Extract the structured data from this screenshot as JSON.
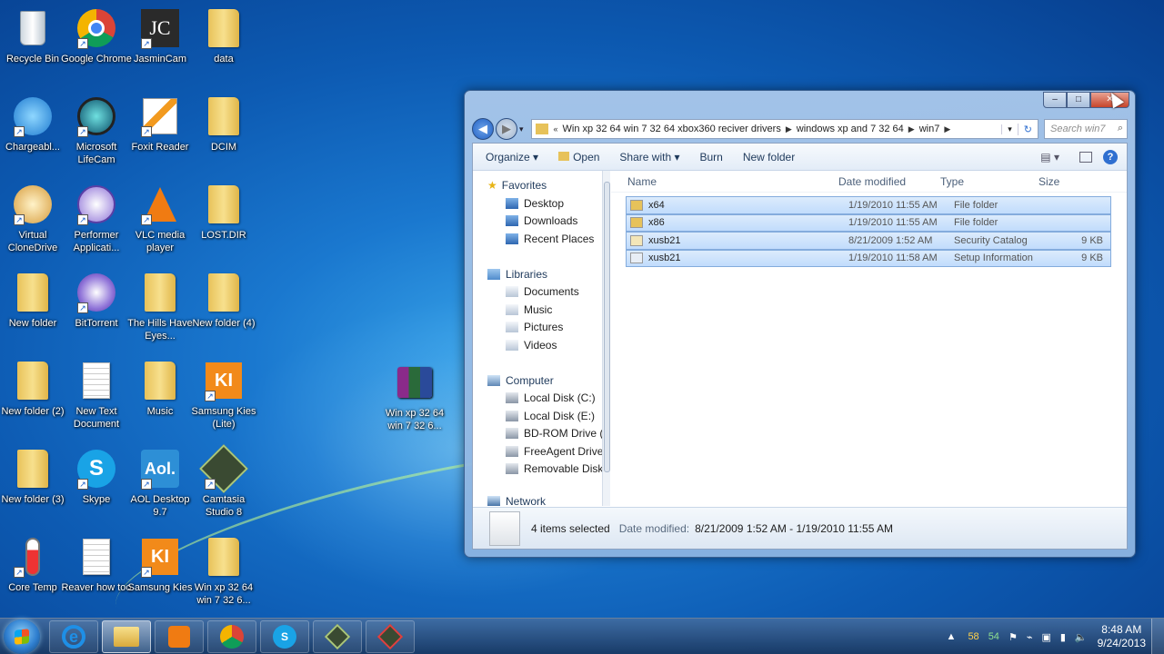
{
  "desktop": {
    "icons": [
      {
        "label": "Recycle Bin",
        "icon": "recycle-bin-icon"
      },
      {
        "label": "Google Chrome",
        "icon": "chrome-icon"
      },
      {
        "label": "JasminCam",
        "icon": "jasmincam-icon"
      },
      {
        "label": "data",
        "icon": "folder-icon"
      },
      {
        "label": "Chargeabl...",
        "icon": "charge-icon"
      },
      {
        "label": "Microsoft LifeCam",
        "icon": "lifecam-icon"
      },
      {
        "label": "Foxit Reader",
        "icon": "foxit-icon"
      },
      {
        "label": "DCIM",
        "icon": "folder-icon"
      },
      {
        "label": "Virtual CloneDrive",
        "icon": "clonedrive-icon"
      },
      {
        "label": "Performer Applicati...",
        "icon": "performer-icon"
      },
      {
        "label": "VLC media player",
        "icon": "vlc-icon"
      },
      {
        "label": "LOST.DIR",
        "icon": "folder-icon"
      },
      {
        "label": "New folder",
        "icon": "folder-icon"
      },
      {
        "label": "BitTorrent",
        "icon": "bittorrent-icon"
      },
      {
        "label": "The Hills Have Eyes...",
        "icon": "folder-icon"
      },
      {
        "label": "New folder (4)",
        "icon": "folder-icon"
      },
      {
        "label": "New folder (2)",
        "icon": "folder-icon"
      },
      {
        "label": "New Text Document",
        "icon": "text-document-icon"
      },
      {
        "label": "Music",
        "icon": "folder-icon"
      },
      {
        "label": "Samsung Kies (Lite)",
        "icon": "kies-lite-icon"
      },
      {
        "label": "New folder (3)",
        "icon": "folder-icon"
      },
      {
        "label": "Skype",
        "icon": "skype-icon"
      },
      {
        "label": "AOL Desktop 9.7",
        "icon": "aol-icon"
      },
      {
        "label": "Camtasia Studio 8",
        "icon": "camtasia-icon"
      },
      {
        "label": "Core Temp",
        "icon": "coretemp-icon"
      },
      {
        "label": "Reaver how too",
        "icon": "text-document-icon"
      },
      {
        "label": "Samsung Kies",
        "icon": "kies-icon"
      },
      {
        "label": "Win xp 32 64 win 7 32 6...",
        "icon": "folder-icon"
      }
    ],
    "archive_icon": {
      "label": "Win xp 32 64 win 7 32 6...",
      "icon": "winrar-archive-icon"
    }
  },
  "explorer": {
    "caption": {
      "minimize": "–",
      "maximize": "□",
      "close": "✕"
    },
    "nav": {
      "back": "◀",
      "forward": "▶",
      "recent": "▾"
    },
    "breadcrumb": {
      "overflow": "«",
      "items": [
        "Win xp 32 64 win 7 32 64 xbox360 reciver drivers",
        "windows xp and 7 32 64",
        "win7"
      ],
      "separator": "▶",
      "dropdown": "▾",
      "refresh": "↻"
    },
    "search_placeholder": "Search win7",
    "toolbar": {
      "organize": "Organize ▾",
      "open": "Open",
      "share_with": "Share with ▾",
      "burn": "Burn",
      "new_folder": "New folder",
      "view": "▤ ▾",
      "help": "?"
    },
    "nav_pane": {
      "favorites": "Favorites",
      "favorites_items": [
        "Desktop",
        "Downloads",
        "Recent Places"
      ],
      "libraries": "Libraries",
      "libraries_items": [
        "Documents",
        "Music",
        "Pictures",
        "Videos"
      ],
      "computer": "Computer",
      "computer_items": [
        "Local Disk (C:)",
        "Local Disk (E:)",
        "BD-ROM Drive (F",
        "FreeAgent Drive (",
        "Removable Disk ("
      ],
      "network": "Network"
    },
    "columns": {
      "name": "Name",
      "date": "Date modified",
      "type": "Type",
      "size": "Size"
    },
    "files": [
      {
        "name": "x64",
        "date": "1/19/2010 11:55 AM",
        "type": "File folder",
        "size": "",
        "icon": "folder-icon"
      },
      {
        "name": "x86",
        "date": "1/19/2010 11:55 AM",
        "type": "File folder",
        "size": "",
        "icon": "folder-icon"
      },
      {
        "name": "xusb21",
        "date": "8/21/2009 1:52 AM",
        "type": "Security Catalog",
        "size": "9 KB",
        "icon": "security-catalog-icon"
      },
      {
        "name": "xusb21",
        "date": "1/19/2010 11:58 AM",
        "type": "Setup Information",
        "size": "9 KB",
        "icon": "setup-info-icon"
      }
    ],
    "status": {
      "selected": "4 items selected",
      "date_label": "Date modified:",
      "date_value": "8/21/2009 1:52 AM - 1/19/2010 11:55 AM"
    }
  },
  "taskbar": {
    "buttons": [
      "internet-explorer-icon",
      "windows-explorer-icon",
      "media-player-icon",
      "chrome-icon",
      "skype-icon",
      "camtasia-icon",
      "camtasia-recorder-icon"
    ],
    "tray": {
      "expand": "▲",
      "temp1": "58",
      "temp2": "54"
    },
    "clock": {
      "time": "8:48 AM",
      "date": "9/24/2013"
    }
  }
}
